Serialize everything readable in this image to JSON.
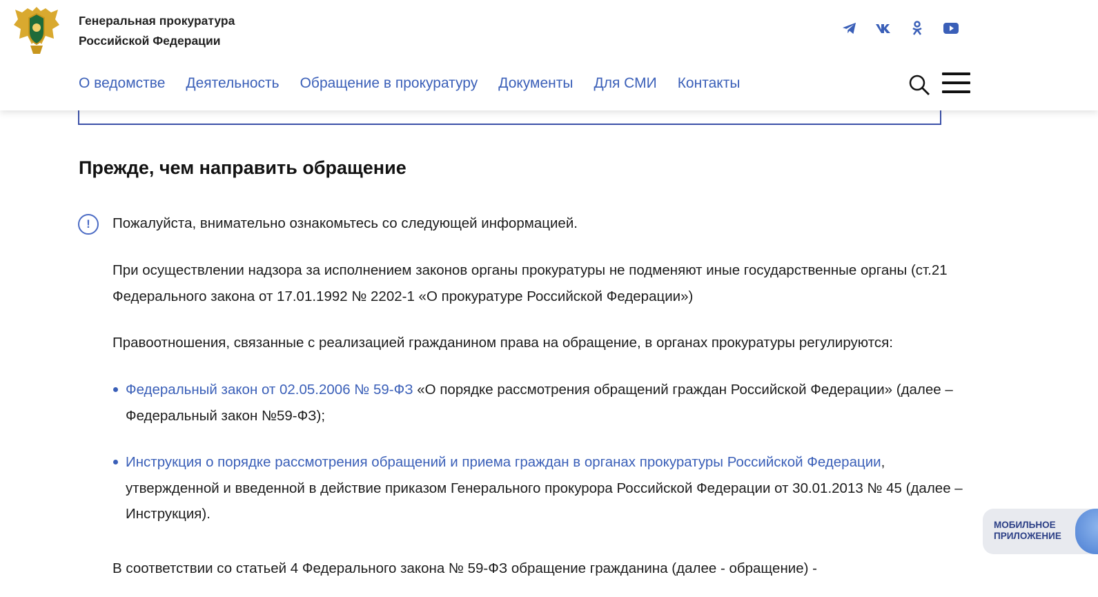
{
  "header": {
    "org_name_line1": "Генеральная прокуратура",
    "org_name_line2": "Российской Федерации",
    "socials": [
      "telegram-icon",
      "vk-icon",
      "odnoklassniki-icon",
      "youtube-icon"
    ],
    "nav": [
      "О ведомстве",
      "Деятельность",
      "Обращение в прокуратуру",
      "Документы",
      "Для СМИ",
      "Контакты"
    ]
  },
  "main": {
    "title": "Прежде, чем направить обращение",
    "notice": "Пожалуйста, внимательно ознакомьтесь со следующей информацией.",
    "para1": "При осуществлении надзора за исполнением законов органы прокуратуры не подменяют иные государственные органы (ст.21 Федерального закона от 17.01.1992 № 2202-1 «О прокуратуре Российской Федерации»)",
    "para2": "Правоотношения, связанные с реализацией гражданином права на обращение, в органах прокуратуры регулируются:",
    "list": [
      {
        "link": "Федеральный закон от 02.05.2006 № 59-ФЗ",
        "rest": " «О порядке рассмотрения обращений граждан Российской Федерации» (далее – Федеральный закон №59-ФЗ);"
      },
      {
        "link": "Инструкция о порядке рассмотрения обращений и приема граждан в органах прокуратуры Российской Федерации",
        "rest": ", утвержденной и введенной в действие приказом Генерального прокурора Российской Федерации от 30.01.2013 № 45 (далее – Инструкция)."
      }
    ],
    "para3": "В соответствии со статьей 4 Федерального закона № 59-ФЗ обращение гражданина (далее - обращение) -"
  },
  "mobile_app": {
    "label": "МОБИЛЬНОЕ\nПРИЛОЖЕНИЕ"
  },
  "colors": {
    "accent": "#3a5fb8",
    "title": "#111111",
    "text": "#1c1c1c"
  }
}
